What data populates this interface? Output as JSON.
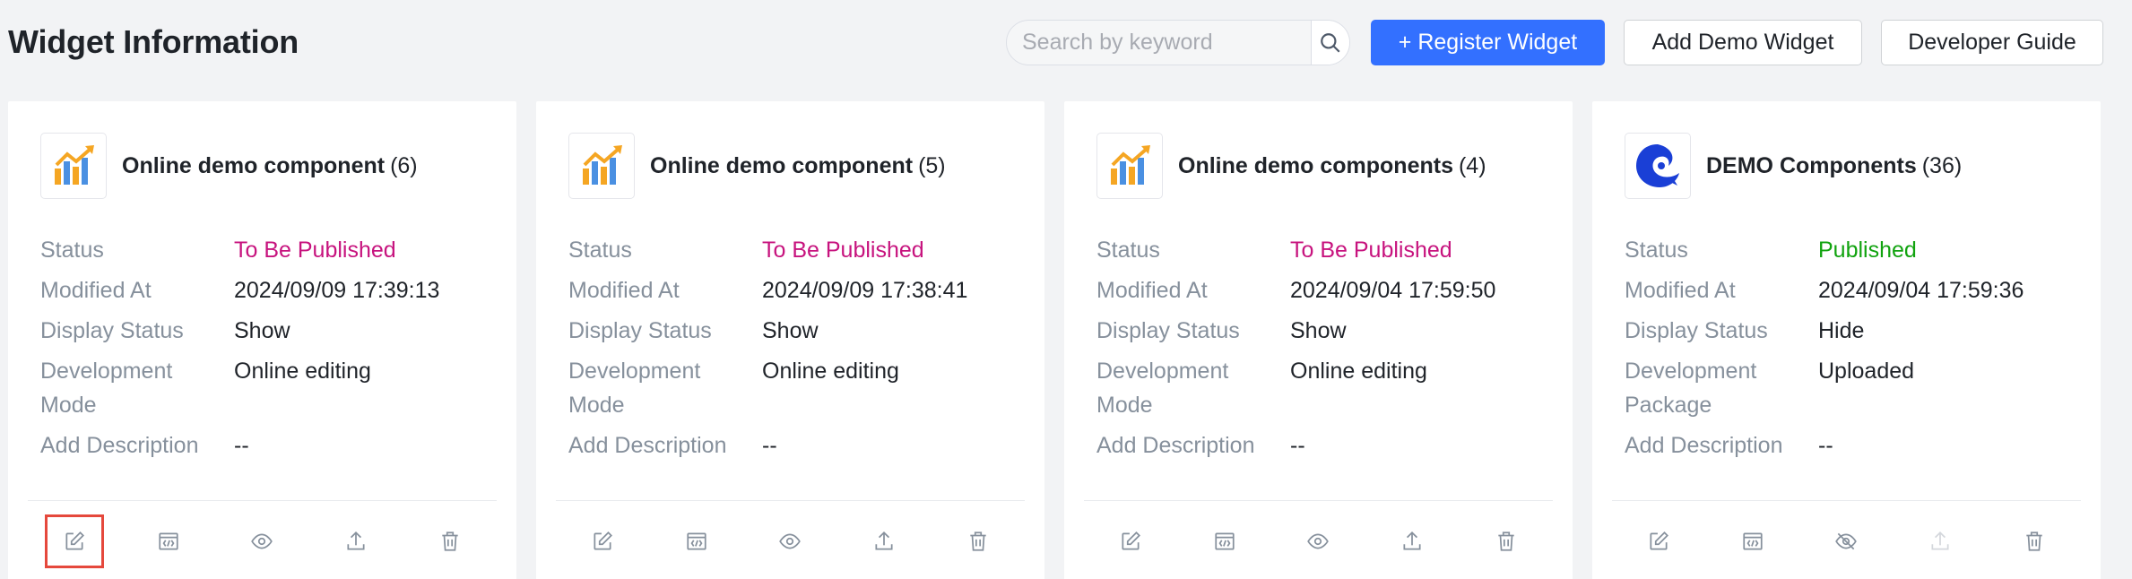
{
  "header": {
    "title": "Widget Information",
    "search_placeholder": "Search by keyword",
    "register_label": "+ Register Widget",
    "add_demo_label": "Add Demo Widget",
    "guide_label": "Developer Guide"
  },
  "labels": {
    "status": "Status",
    "modified": "Modified At",
    "display": "Display Status",
    "dev_mode": "Development Mode",
    "dev_package": "Development Package",
    "desc": "Add Description"
  },
  "cards": [
    {
      "title": "Online demo component",
      "count": "(6)",
      "status": "To Be Published",
      "modified": "2024/09/09 17:39:13",
      "display": "Show",
      "dev_value": "Online editing",
      "desc": "--"
    },
    {
      "title": "Online demo component",
      "count": "(5)",
      "status": "To Be Published",
      "modified": "2024/09/09 17:38:41",
      "display": "Show",
      "dev_value": "Online editing",
      "desc": "--"
    },
    {
      "title": "Online demo components",
      "count": "(4)",
      "status": "To Be Published",
      "modified": "2024/09/04 17:59:50",
      "display": "Show",
      "dev_value": "Online editing",
      "desc": "--"
    },
    {
      "title": "DEMO Components",
      "count": "(36)",
      "status": "Published",
      "modified": "2024/09/04 17:59:36",
      "display": "Hide",
      "dev_value": "Uploaded",
      "desc": "--"
    }
  ],
  "colors": {
    "primary": "#3370ff",
    "pending": "#c7137e",
    "published": "#11a30f",
    "highlight": "#e5483c"
  },
  "icons": [
    "edit-icon",
    "code-icon",
    "eye-icon",
    "eye-off-icon",
    "upload-icon",
    "trash-icon",
    "search-icon"
  ]
}
